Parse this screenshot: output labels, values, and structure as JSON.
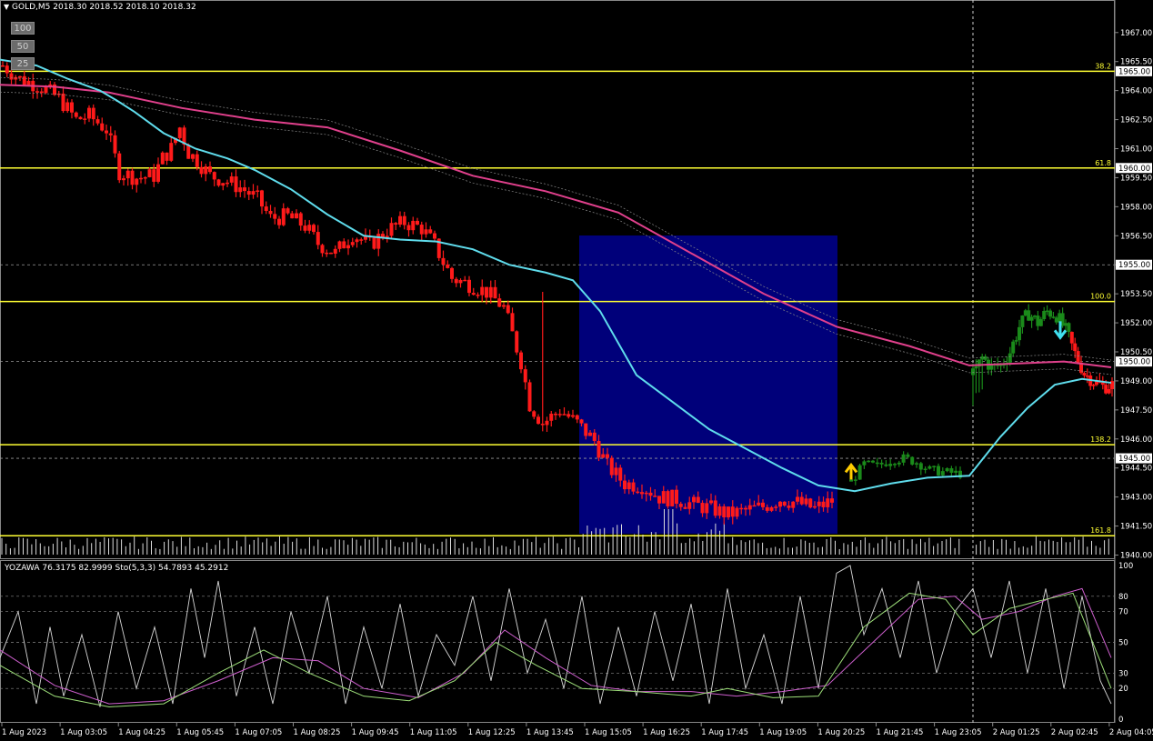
{
  "header": {
    "symbol_title": "GOLD,M5  2018.30 2018.52 2018.10 2018.32",
    "sub_title": "YOZAWA 76.3175 82.9999  Sto(5,3,3) 54.7893 45.2912"
  },
  "toggles": [
    "100",
    "50",
    "25"
  ],
  "colors": {
    "background": "#000000",
    "bear_bar": "#ff1a1a",
    "bull_bar": "#1a8a1a",
    "ma_fast": "#5fdcec",
    "ma_slow": "#e0408c",
    "level_line": "#ffff33",
    "range_box": "#00007a",
    "stoch_main": "#9ee07a",
    "stoch_signal": "#d060d0",
    "yozawa": "#d8d8d8",
    "up_arrow": "#ffcc00",
    "down_arrow": "#40e0f0"
  },
  "chart_data": {
    "type": "candlestick",
    "grid": true,
    "price_axis": {
      "ylim": [
        1940.0,
        1968.0
      ],
      "ticks": [
        "1967.00",
        "1965.50",
        "1964.00",
        "1962.50",
        "1961.00",
        "1959.50",
        "1958.00",
        "1956.50",
        "1955.00",
        "1953.50",
        "1952.00",
        "1950.50",
        "1949.00",
        "1947.50",
        "1946.00",
        "1944.50",
        "1943.00",
        "1941.50",
        "1940.00"
      ],
      "highlight_ticks": [
        "1965.00",
        "1960.00",
        "1955.00",
        "1950.00",
        "1945.00"
      ]
    },
    "time_axis": {
      "labels": [
        "1 Aug 2023",
        "1 Aug 03:05",
        "1 Aug 04:25",
        "1 Aug 05:45",
        "1 Aug 07:05",
        "1 Aug 08:25",
        "1 Aug 09:45",
        "1 Aug 11:05",
        "1 Aug 12:25",
        "1 Aug 13:45",
        "1 Aug 15:05",
        "1 Aug 16:25",
        "1 Aug 17:45",
        "1 Aug 19:05",
        "1 Aug 20:25",
        "1 Aug 21:45",
        "1 Aug 23:05",
        "2 Aug 01:25",
        "2 Aug 02:45",
        "2 Aug 04:05"
      ]
    },
    "fib_levels": [
      {
        "label": "38.2",
        "price": 1965.0
      },
      {
        "label": "61.8",
        "price": 1960.0
      },
      {
        "label": "100.0",
        "price": 1953.1
      },
      {
        "label": "138.2",
        "price": 1945.7
      },
      {
        "label": "161.8",
        "price": 1941.0
      }
    ],
    "close_path": {
      "x": [
        0,
        4,
        8,
        13,
        17,
        20,
        24,
        27,
        31,
        35,
        37,
        39,
        41,
        43,
        45,
        48,
        51,
        55,
        59,
        62,
        66,
        70,
        73,
        77,
        81,
        85,
        89,
        93,
        97,
        100,
        104,
        108,
        112,
        116,
        120,
        122,
        125,
        129,
        133,
        137,
        140,
        144,
        148,
        152,
        156,
        160,
        164,
        168,
        172,
        176,
        180,
        184,
        188,
        192
      ],
      "y": [
        1965.3,
        1964.6,
        1964.3,
        1963.6,
        1962.5,
        1962.7,
        1962.0,
        1959.8,
        1959.5,
        1959.6,
        1960.5,
        1961.0,
        1962.1,
        1960.8,
        1960.4,
        1959.6,
        1959.4,
        1959.0,
        1958.4,
        1957.4,
        1957.5,
        1957.0,
        1956.1,
        1955.6,
        1956.6,
        1956.0,
        1956.8,
        1957.2,
        1956.9,
        1956.0,
        1954.3,
        1954.0,
        1953.6,
        1952.8,
        1950.0,
        1947.8,
        1946.8,
        1947.5,
        1946.8,
        1945.9,
        1944.6,
        1943.7,
        1943.6,
        1943.0,
        1942.9,
        1942.6,
        1942.4,
        1942.1,
        1942.3,
        1942.5,
        1942.9,
        1942.7,
        1942.4,
        1942.8
      ],
      "spike": {
        "x": 125,
        "high": 1953.6
      }
    },
    "session2_path": {
      "x": [
        0,
        3,
        6,
        9,
        12,
        15,
        18,
        21,
        25
      ],
      "y": [
        1943.8,
        1944.7,
        1944.6,
        1944.9,
        1945.0,
        1944.8,
        1944.4,
        1944.3,
        1944.2
      ]
    },
    "session3_path": {
      "x": [
        0,
        3,
        6,
        9,
        12,
        15,
        18,
        21,
        24,
        27,
        30,
        33,
        36,
        39,
        42,
        45
      ],
      "y": [
        1949.3,
        1950.2,
        1949.7,
        1949.8,
        1950.5,
        1951.8,
        1952.5,
        1952.0,
        1952.6,
        1952.4,
        1951.6,
        1950.4,
        1949.4,
        1949.0,
        1948.7,
        1948.8
      ]
    },
    "ma_fast": {
      "x": [
        0,
        40,
        75,
        110,
        128,
        148,
        180,
        215,
        250,
        280,
        320,
        360,
        400,
        440,
        480,
        520,
        560,
        600,
        630,
        660,
        700,
        740,
        780,
        820,
        860,
        900,
        940,
        980,
        1020,
        1066,
        1100,
        1130,
        1160,
        1190,
        1222
      ],
      "y": [
        1965.6,
        1965.3,
        1964.6,
        1964.0,
        1963.5,
        1962.9,
        1961.8,
        1961.0,
        1960.5,
        1959.9,
        1958.9,
        1957.6,
        1956.5,
        1956.3,
        1956.2,
        1955.8,
        1955.0,
        1954.6,
        1954.2,
        1952.6,
        1949.3,
        1947.9,
        1946.5,
        1945.5,
        1944.5,
        1943.6,
        1943.3,
        1943.7,
        1944.0,
        1944.1,
        1946.1,
        1947.6,
        1948.8,
        1949.1,
        1948.9
      ]
    },
    "ma_slow": {
      "x": [
        0,
        60,
        120,
        200,
        280,
        360,
        440,
        520,
        600,
        680,
        760,
        840,
        920,
        1000,
        1066,
        1120,
        1170,
        1222
      ],
      "y": [
        1964.3,
        1964.2,
        1963.9,
        1963.1,
        1962.5,
        1962.1,
        1960.9,
        1959.6,
        1958.8,
        1957.7,
        1955.6,
        1953.5,
        1951.8,
        1950.8,
        1949.8,
        1949.9,
        1950.0,
        1949.7
      ]
    },
    "arrows": [
      {
        "direction": "up",
        "x": 936,
        "price": 1944.0
      },
      {
        "direction": "down",
        "x": 1166,
        "price": 1951.8
      }
    ],
    "oscillator": {
      "levels": [
        "100",
        "80",
        "70",
        "50",
        "30",
        "20",
        "0"
      ],
      "stoch_main": {
        "x": [
          0,
          60,
          120,
          180,
          240,
          290,
          340,
          400,
          450,
          500,
          545,
          590,
          640,
          700,
          760,
          800,
          850,
          900,
          950,
          1000,
          1040,
          1070,
          1110,
          1150,
          1180,
          1222
        ],
        "y": [
          35,
          15,
          8,
          10,
          30,
          45,
          30,
          15,
          12,
          25,
          50,
          35,
          20,
          18,
          15,
          20,
          14,
          15,
          60,
          82,
          78,
          55,
          72,
          78,
          82,
          20
        ]
      },
      "stoch_signal": {
        "x": [
          0,
          60,
          120,
          180,
          240,
          300,
          350,
          400,
          460,
          510,
          555,
          600,
          650,
          700,
          760,
          810,
          860,
          910,
          960,
          1010,
          1050,
          1080,
          1120,
          1160,
          1190,
          1222
        ],
        "y": [
          45,
          22,
          10,
          12,
          25,
          40,
          38,
          20,
          14,
          30,
          58,
          40,
          22,
          18,
          18,
          15,
          18,
          22,
          50,
          78,
          80,
          65,
          70,
          80,
          85,
          40
        ]
      },
      "yozawa": {
        "x": [
          0,
          20,
          40,
          55,
          70,
          90,
          110,
          130,
          150,
          170,
          190,
          210,
          225,
          240,
          260,
          280,
          300,
          320,
          340,
          360,
          380,
          400,
          420,
          440,
          460,
          480,
          500,
          520,
          540,
          560,
          580,
          600,
          620,
          640,
          660,
          680,
          700,
          720,
          740,
          760,
          780,
          800,
          820,
          840,
          860,
          880,
          900,
          920,
          935,
          950,
          970,
          990,
          1010,
          1030,
          1050,
          1070,
          1090,
          1110,
          1130,
          1150,
          1170,
          1190,
          1210,
          1222
        ],
        "y": [
          40,
          70,
          10,
          60,
          15,
          55,
          8,
          70,
          20,
          60,
          10,
          85,
          40,
          90,
          15,
          60,
          10,
          70,
          30,
          80,
          10,
          60,
          20,
          75,
          15,
          55,
          35,
          80,
          25,
          85,
          30,
          65,
          20,
          80,
          10,
          60,
          15,
          70,
          25,
          75,
          10,
          85,
          20,
          55,
          10,
          80,
          20,
          95,
          100,
          55,
          85,
          40,
          90,
          30,
          70,
          85,
          40,
          90,
          30,
          85,
          20,
          80,
          25,
          10
        ]
      }
    }
  }
}
